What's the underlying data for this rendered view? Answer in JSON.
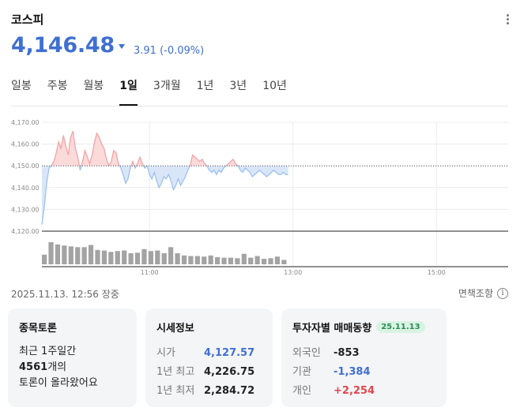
{
  "header": {
    "title": "코스피",
    "price": "4,146.48",
    "change": "3.91 (-0.09%)",
    "change_color": "#3f6fd1"
  },
  "tabs": [
    {
      "label": "일봉",
      "active": false
    },
    {
      "label": "주봉",
      "active": false
    },
    {
      "label": "월봉",
      "active": false
    },
    {
      "label": "1일",
      "active": true
    },
    {
      "label": "3개월",
      "active": false
    },
    {
      "label": "1년",
      "active": false
    },
    {
      "label": "3년",
      "active": false
    },
    {
      "label": "10년",
      "active": false
    }
  ],
  "chart_data": {
    "type": "area",
    "ylim": [
      4120,
      4170
    ],
    "yticks": [
      "4,170.00",
      "4,160.00",
      "4,150.00",
      "4,140.00",
      "4,130.00",
      "4,120.00"
    ],
    "ytick_values": [
      4170,
      4160,
      4150,
      4140,
      4130,
      4120
    ],
    "xticks": [
      "11:00",
      "13:00",
      "15:00"
    ],
    "xtick_minutes": [
      90,
      210,
      330
    ],
    "xlim_minutes": [
      0,
      390
    ],
    "baseline": 4150,
    "up_color": "#f4a3a8",
    "down_color": "#9ec0ef",
    "x_minutes": [
      0,
      2,
      4,
      6,
      8,
      10,
      12,
      14,
      16,
      18,
      20,
      22,
      24,
      26,
      28,
      30,
      32,
      34,
      36,
      38,
      40,
      42,
      44,
      46,
      48,
      50,
      52,
      54,
      56,
      58,
      60,
      62,
      64,
      66,
      68,
      70,
      72,
      74,
      76,
      78,
      80,
      82,
      84,
      86,
      88,
      90,
      92,
      94,
      96,
      98,
      100,
      102,
      104,
      106,
      108,
      110,
      112,
      114,
      116,
      118,
      120,
      122,
      124,
      126,
      128,
      130,
      132,
      134,
      136,
      138,
      140,
      142,
      144,
      146,
      148,
      150,
      152,
      154,
      156,
      158,
      160,
      162,
      164,
      166,
      168,
      170,
      172,
      174,
      176,
      178,
      180,
      182,
      184,
      186,
      188,
      190,
      192,
      194,
      196,
      198,
      200,
      202,
      204,
      206
    ],
    "values": [
      4123,
      4131,
      4142,
      4149,
      4150,
      4152,
      4156,
      4161,
      4158,
      4164,
      4159,
      4155,
      4163,
      4166,
      4158,
      4154,
      4148,
      4152,
      4157,
      4154,
      4151,
      4155,
      4161,
      4165,
      4163,
      4160,
      4158,
      4153,
      4150,
      4152,
      4157,
      4156,
      4151,
      4149,
      4146,
      4142,
      4144,
      4149,
      4152,
      4149,
      4151,
      4154,
      4151,
      4149,
      4150,
      4146,
      4144,
      4147,
      4143,
      4140,
      4142,
      4145,
      4144,
      4146,
      4143,
      4139,
      4141,
      4144,
      4141,
      4143,
      4145,
      4148,
      4150,
      4155,
      4154,
      4153,
      4152,
      4153,
      4151,
      4150,
      4148,
      4147,
      4148,
      4146,
      4148,
      4147,
      4149,
      4150,
      4151,
      4152,
      4153,
      4151,
      4150,
      4148,
      4147,
      4149,
      4148,
      4147,
      4145,
      4146,
      4147,
      4148,
      4147,
      4146,
      4145,
      4146,
      4147,
      4148,
      4147,
      4146,
      4146,
      4147,
      4146,
      4146
    ],
    "volume": [
      0.35,
      0.8,
      0.72,
      0.68,
      0.65,
      0.62,
      0.62,
      0.7,
      0.52,
      0.5,
      0.45,
      0.48,
      0.5,
      0.4,
      0.42,
      0.55,
      0.48,
      0.5,
      0.4,
      0.62,
      0.4,
      0.32,
      0.3,
      0.3,
      0.28,
      0.32,
      0.26,
      0.24,
      0.24,
      0.22,
      0.38,
      0.24,
      0.3,
      0.2,
      0.22,
      0.28,
      0.16
    ]
  },
  "timestamp": "2025.11.13. 12:56 장중",
  "disclaimer": "면책조항",
  "disclaimer_icon": "i",
  "cards": {
    "forum": {
      "title": "종목토론",
      "line1": "최근 1주일간",
      "count": "4561",
      "count_suffix": "개의",
      "line3": "토론이 올라왔어요"
    },
    "market": {
      "title": "시세정보",
      "rows": [
        {
          "label": "시가",
          "value": "4,127.57"
        },
        {
          "label": "1년 최고",
          "value": "4,226.75"
        },
        {
          "label": "1년 최저",
          "value": "2,284.72"
        }
      ]
    },
    "investors": {
      "title": "투자자별 매매동향",
      "date": "25.11.13",
      "rows": [
        {
          "label": "외국인",
          "value": "-853"
        },
        {
          "label": "기관",
          "value": "-1,384"
        },
        {
          "label": "개인",
          "value": "+2,254"
        }
      ]
    }
  }
}
